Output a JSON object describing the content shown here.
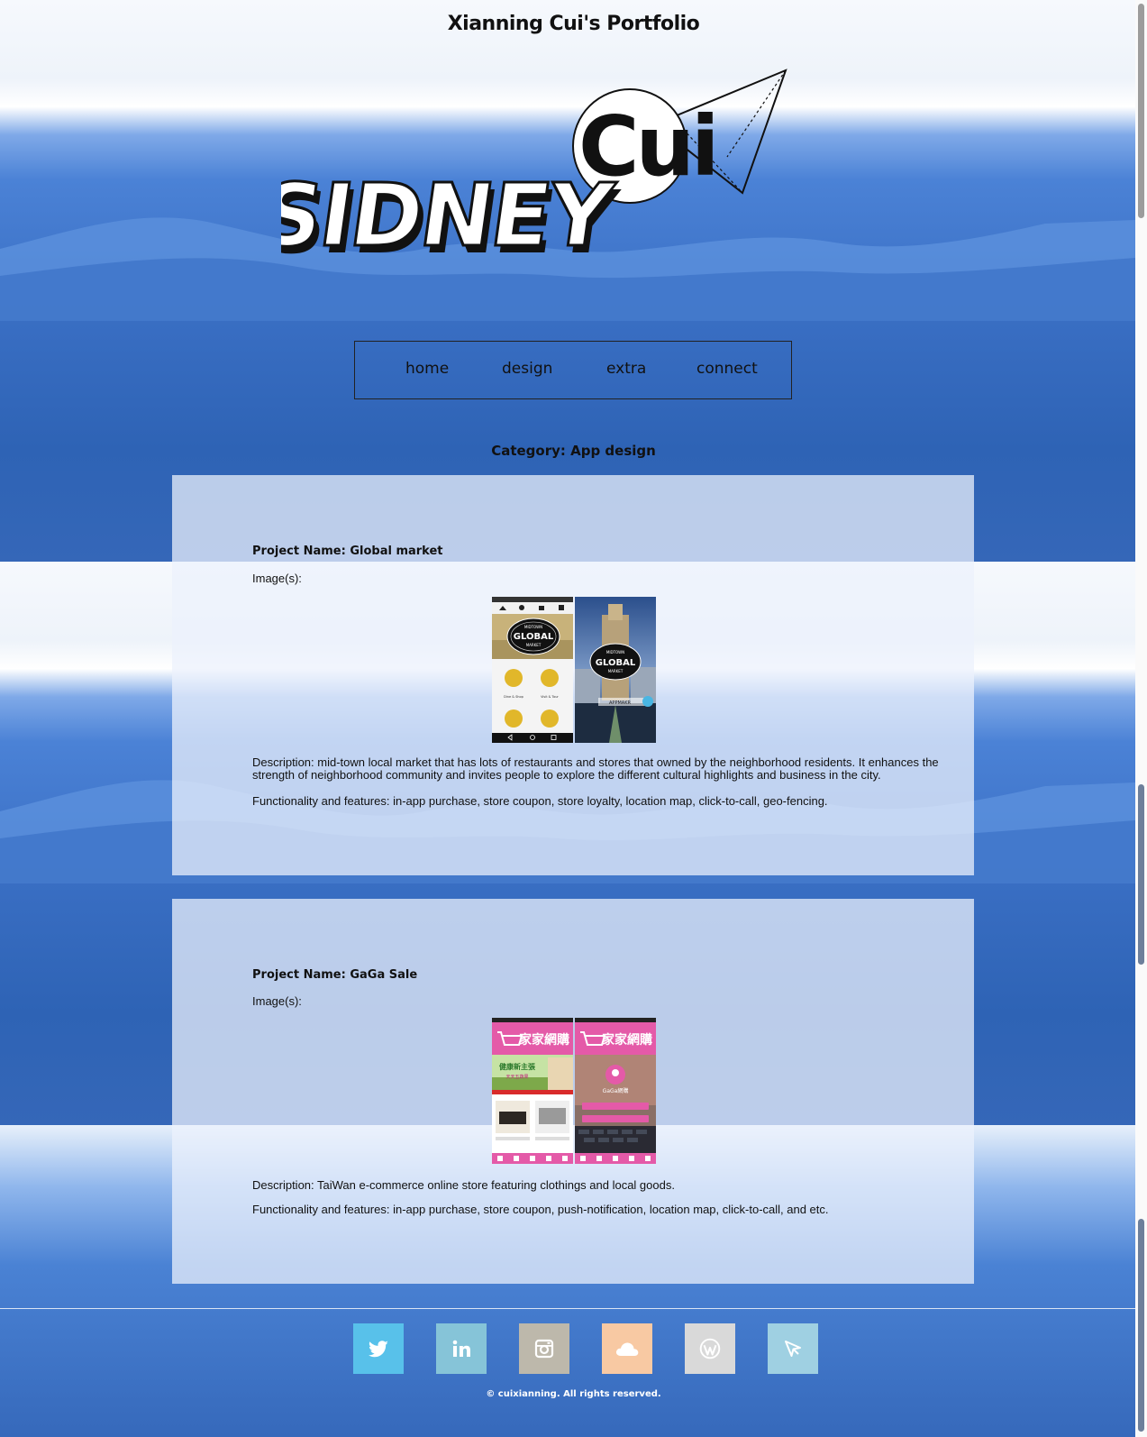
{
  "header": {
    "site_title": "Xianning Cui's Portfolio",
    "logo_top_text": "Cui",
    "logo_main_text": "SIDNEY"
  },
  "nav": {
    "items": [
      {
        "label": "home"
      },
      {
        "label": "design"
      },
      {
        "label": "extra"
      },
      {
        "label": "connect"
      }
    ]
  },
  "category": {
    "title": "Category: App design"
  },
  "projects": [
    {
      "name": "Project Name: Global market",
      "images_label": "Image(s):",
      "description": "Description: mid-town local market that has lots of restaurants and stores that owned by the neighborhood residents. It enhances the strength of neighborhood community and invites people to explore the different cultural highlights and business in the city.",
      "features": "Functionality and features: in-app purchase, store coupon, store loyalty, location map, click-to-call, geo-fencing.",
      "screenshot_text": {
        "badge_top": "MIDTOWN",
        "badge_main": "GLOBAL",
        "badge_bottom": "MARKET",
        "tile_1": "Dine & Shop",
        "tile_2": "Visit & Tour",
        "appmakr": "APPMAKR"
      }
    },
    {
      "name": "Project Name: GaGa Sale",
      "images_label": "Image(s):",
      "description": "Description: TaiWan e-commerce online store featuring clothings and local goods.",
      "features": "Functionality and features: in-app purchase, store coupon, push-notification, location map, click-to-call, and etc.",
      "screenshot_text": {
        "brand": "家家網購",
        "promo": "健康新主張",
        "promo_sub": "天天五蔬果",
        "login_title": "GaGa網購"
      }
    }
  ],
  "footer": {
    "social": [
      {
        "icon": "twitter-icon",
        "color": "#58c1ea"
      },
      {
        "icon": "linkedin-icon",
        "color": "#86c4d8"
      },
      {
        "icon": "instagram-icon",
        "color": "#bdb8ab"
      },
      {
        "icon": "cloud-icon",
        "color": "#f8c9a3"
      },
      {
        "icon": "wordpress-icon",
        "color": "#d9d9d9"
      },
      {
        "icon": "send-icon",
        "color": "#9fd0e2"
      }
    ],
    "copyright": "© cuixianning. All rights reserved."
  }
}
